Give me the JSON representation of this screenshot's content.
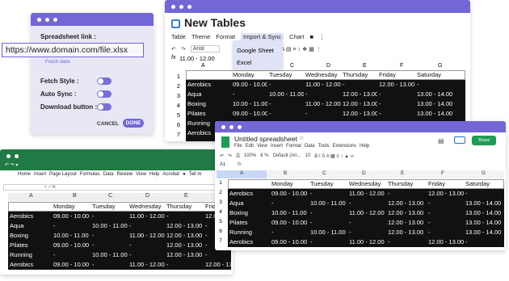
{
  "accent": "#7367d8",
  "settings_panel": {
    "spreadsheet_link_label": "Spreadsheet link :",
    "url_value": "https://www.domain.com/file.xlsx",
    "fetch_button": "Fetch data",
    "fetch_style_label": "Fetch Style :",
    "auto_sync_label": "Auto Sync :",
    "download_button_label": "Download button :",
    "cancel": "CANCEL",
    "done": "DONE"
  },
  "new_tables": {
    "title": "New Tables",
    "menu": [
      "Table",
      "Theme",
      "Format",
      "Import & Sync",
      "Chart"
    ],
    "font": "Arial",
    "formula_prefix": "fx",
    "formula_value": "11.00 - 12.00",
    "dropdown": [
      "Google Sheet",
      "Excel"
    ],
    "columns": [
      "A",
      "B",
      "C",
      "D",
      "E",
      "F",
      "G"
    ],
    "rows": [
      "1",
      "2",
      "3",
      "4",
      "5",
      "6",
      "7"
    ]
  },
  "excel": {
    "menu": [
      "Home",
      "Insert",
      "Page Layout",
      "Formulas",
      "Data",
      "Review",
      "View",
      "Help",
      "Acrobat",
      "Tell m"
    ],
    "columns": [
      "A",
      "B",
      "C",
      "D",
      "E"
    ]
  },
  "google_sheets": {
    "title": "Untitled spreadsheet",
    "menu": [
      "File",
      "Edit",
      "View",
      "Insert",
      "Format",
      "Data",
      "Tools",
      "Extensions",
      "Help"
    ],
    "share": "Share",
    "cell_ref": "A1",
    "zoom": "100%",
    "font": "Default (Ari...",
    "font_size": "10",
    "columns": [
      "A",
      "B",
      "C",
      "D",
      "E",
      "F",
      "G"
    ],
    "rows": [
      "1",
      "2",
      "3",
      "4",
      "5",
      "6",
      "7"
    ]
  },
  "table": {
    "header": [
      "",
      "Monday",
      "Tuesday",
      "Wednesday",
      "Thursday",
      "Friday",
      "Saturday"
    ],
    "rows": [
      [
        "Aerobics",
        "09.00 - 10.00",
        "-",
        "11.00 - 12.00",
        "-",
        "12.00 - 13.00",
        "-"
      ],
      [
        "Aqua",
        "-",
        "10.00 - 11.00",
        "-",
        "12.00 - 13.00",
        "-",
        "13.00 - 14.00"
      ],
      [
        "Boxing",
        "10.00 - 11.00",
        "-",
        "11.00 - 12.00",
        "12.00 - 13.00",
        "-",
        "13.00 - 14.00"
      ],
      [
        "Pilates",
        "09.00 - 10.00",
        "-",
        "-",
        "12.00 - 13.00",
        "-",
        "13.00 - 14.00"
      ],
      [
        "Running",
        "-",
        "10.00 - 11.00",
        "-",
        "12.00 - 13.00",
        "-",
        "13.00 - 14.00"
      ],
      [
        "Aerobics",
        "09.00 - 10.00",
        "-",
        "11.00 - 12.00",
        "-",
        "12.00 - 13.00",
        "-"
      ]
    ]
  }
}
